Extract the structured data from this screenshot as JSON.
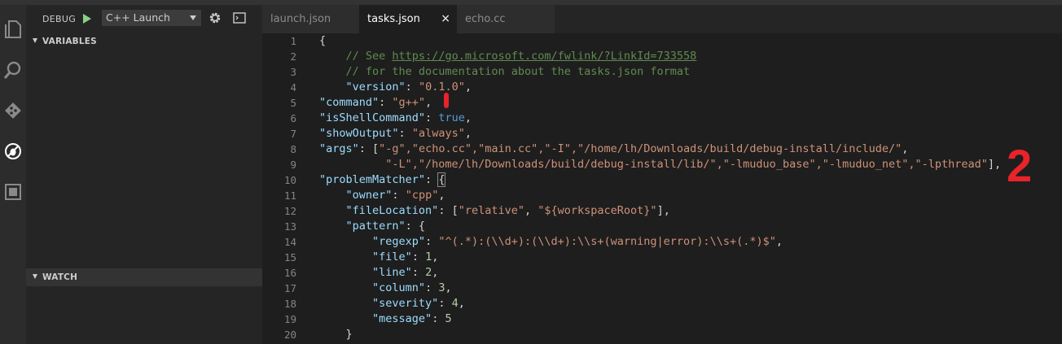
{
  "activity_bar": {
    "icons": [
      "explorer-icon",
      "search-icon",
      "git-icon",
      "debug-icon",
      "extensions-icon"
    ]
  },
  "debug": {
    "title": "DEBUG",
    "configuration": "C++ Launch",
    "variables_label": "VARIABLES",
    "watch_label": "WATCH"
  },
  "tabs": [
    {
      "label": "launch.json",
      "active": false
    },
    {
      "label": "tasks.json",
      "active": true,
      "close": "×"
    },
    {
      "label": "echo.cc",
      "active": false
    }
  ],
  "editor": {
    "line_numbers": [
      "1",
      "2",
      "3",
      "4",
      "5",
      "6",
      "7",
      "8",
      "9",
      "10",
      "11",
      "12",
      "13",
      "14",
      "15",
      "16",
      "17",
      "18",
      "19",
      "20"
    ],
    "url": "https://go.microsoft.com/fwlink/?LinkId=733558",
    "comment_prefix": "// See ",
    "comment2": "// for the documentation about the tasks.json format",
    "keys": {
      "version": "\"version\"",
      "command": "\"command\"",
      "isShellCommand": "\"isShellCommand\"",
      "showOutput": "\"showOutput\"",
      "args": "\"args\"",
      "problemMatcher": "\"problemMatcher\"",
      "owner": "\"owner\"",
      "fileLocation": "\"fileLocation\"",
      "pattern": "\"pattern\"",
      "regexp": "\"regexp\"",
      "file": "\"file\"",
      "line": "\"line\"",
      "column": "\"column\"",
      "severity": "\"severity\"",
      "message": "\"message\""
    },
    "values": {
      "version": "\"0.1.0\"",
      "command": "\"g++\"",
      "isShellCommand": "true",
      "showOutput": "\"always\"",
      "args_line1": "\"-g\",\"echo.cc\",\"main.cc\",\"-I\",\"/home/lh/Downloads/build/debug-install/include/\"",
      "args_line2": "\"-L\",\"/home/lh/Downloads/build/debug-install/lib/\",\"-lmuduo_base\",\"-lmuduo_net\",\"-lpthread\"",
      "owner": "\"cpp\"",
      "fileLocation_1": "\"relative\"",
      "fileLocation_2": "\"${workspaceRoot}\"",
      "regexp": "\"^(.*):(\\\\d+):(\\\\d+):\\\\s+(warning|error):\\\\s+(.*)$\"",
      "file": "1",
      "line": "2",
      "column": "3",
      "severity": "4",
      "message": "5"
    }
  },
  "annotations": {
    "mark2": "2"
  },
  "colors": {
    "annotation_red": "#e8232a",
    "key": "#9cdcfe",
    "string": "#ce9178",
    "number": "#b5cea8",
    "keyword": "#569cd6",
    "comment": "#608b4e"
  }
}
